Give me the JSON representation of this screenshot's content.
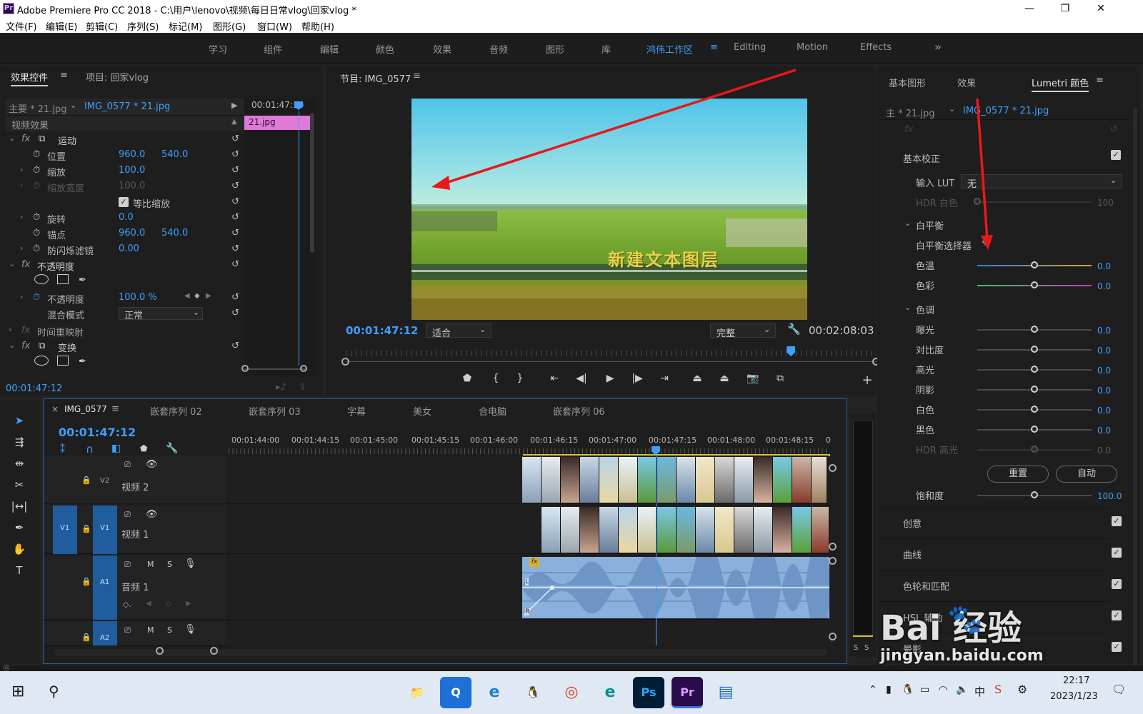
{
  "window": {
    "title": "Adobe Premiere Pro CC 2018 - C:\\用户\\lenovo\\视频\\每日日常vlog\\回家vlog *",
    "icon_label": "Pr",
    "minimize": "—",
    "maximize": "❐",
    "close": "✕"
  },
  "menu": [
    "文件(F)",
    "编辑(E)",
    "剪辑(C)",
    "序列(S)",
    "标记(M)",
    "图形(G)",
    "窗口(W)",
    "帮助(H)"
  ],
  "workspaces": {
    "items": [
      "学习",
      "组件",
      "编辑",
      "颜色",
      "效果",
      "音频",
      "图形",
      "库",
      "鸿伟工作区",
      "Editing",
      "Motion",
      "Effects"
    ],
    "active": "鸿伟工作区",
    "more": "»"
  },
  "effect_controls": {
    "tab_active": "效果控件",
    "tab_project": "项目: 回家vlog",
    "master": "主要 * 21.jpg",
    "clip": "IMG_0577 * 21.jpg",
    "mini_timecode": "00:01:47:10",
    "clip_bar": "21.jpg",
    "section_video": "视频效果",
    "motion": "运动",
    "position_label": "位置",
    "position_x": "960.0",
    "position_y": "540.0",
    "scale_label": "缩放",
    "scale_value": "100.0",
    "scale_width_label": "缩放宽度",
    "scale_width_value": "100.0",
    "uniform_scale": "等比缩放",
    "rotation_label": "旋转",
    "rotation_value": "0.0",
    "anchor_label": "锚点",
    "anchor_x": "960.0",
    "anchor_y": "540.0",
    "flicker_label": "防闪烁滤镜",
    "flicker_value": "0.00",
    "opacity_section": "不透明度",
    "opacity_label": "不透明度",
    "opacity_value": "100.0 %",
    "blend_label": "混合模式",
    "blend_value": "正常",
    "time_remap": "时间重映射",
    "transform": "变换",
    "timecode": "00:01:47:12"
  },
  "program": {
    "title": "节目: IMG_0577",
    "overlay_text": "新建文本图层",
    "timecode": "00:01:47:12",
    "fit": "适合",
    "quality": "完整",
    "duration": "00:02:08:03",
    "playhead_fraction": 0.84
  },
  "timeline": {
    "close": "×",
    "tabs": [
      "IMG_0577",
      "嵌套序列 02",
      "嵌套序列 03",
      "字幕",
      "美女",
      "合电脑",
      "嵌套序列 06"
    ],
    "timecode": "00:01:47:12",
    "ruler": [
      "00:01:44:00",
      "00:01:44:15",
      "00:01:45:00",
      "00:01:45:15",
      "00:01:46:00",
      "00:01:46:15",
      "00:01:47:00",
      "00:01:47:15",
      "00:01:48:00",
      "00:01:48:15",
      "0"
    ],
    "v2_id": "V2",
    "v2_name": "视频 2",
    "v1_src": "V1",
    "v1_id": "V1",
    "v1_name": "视频 1",
    "a1_id": "A1",
    "a1_name": "音频 1",
    "a2_id": "A2",
    "m_label": "M",
    "s_label": "S",
    "fx_badge": "fx",
    "left_ch": "L",
    "right_ch": "R"
  },
  "meter": {
    "solo_left": "S",
    "solo_right": "S"
  },
  "lumetri": {
    "tabs": [
      "基本图形",
      "效果",
      "Lumetri 颜色"
    ],
    "active_tab": "Lumetri 颜色",
    "master": "主 * 21.jpg",
    "clip": "IMG_0577 * 21.jpg",
    "fx": "fx",
    "basic": "基本校正",
    "input_lut_label": "输入 LUT",
    "input_lut_value": "无",
    "hdr_white_label": "HDR 白色",
    "hdr_white_value": "100",
    "white_balance": "白平衡",
    "wb_picker": "白平衡选择器",
    "temp_label": "色温",
    "temp_value": "0.0",
    "tint_label": "色彩",
    "tint_value": "0.0",
    "tone": "色调",
    "exposure_label": "曝光",
    "exposure_value": "0.0",
    "contrast_label": "对比度",
    "contrast_value": "0.0",
    "highlights_label": "高光",
    "highlights_value": "0.0",
    "shadows_label": "阴影",
    "shadows_value": "0.0",
    "whites_label": "白色",
    "whites_value": "0.0",
    "blacks_label": "黑色",
    "blacks_value": "0.0",
    "hdr_spec_label": "HDR 高光",
    "hdr_spec_value": "0.0",
    "reset": "重置",
    "auto": "自动",
    "saturation_label": "饱和度",
    "saturation_value": "100.0",
    "sections": [
      "创意",
      "曲线",
      "色轮和匹配",
      "HSL 辅助",
      "晕影"
    ]
  },
  "watermark": {
    "brand": "Bai  经验",
    "url": "jingyan.baidu.com"
  },
  "taskbar": {
    "apps": [
      "📁",
      "Q",
      "e",
      "🐧",
      "◎",
      "e",
      "Ps",
      "Pr",
      "▤"
    ],
    "tray_ime": "中",
    "time": "22:17",
    "date": "2023/1/23"
  },
  "colors": {
    "accent": "#3f9fff",
    "clip_pink": "#e07ad8",
    "arrow": "#e81818",
    "track_blue": "#1f5d9e",
    "audio_wave": "#8ab0dc"
  }
}
